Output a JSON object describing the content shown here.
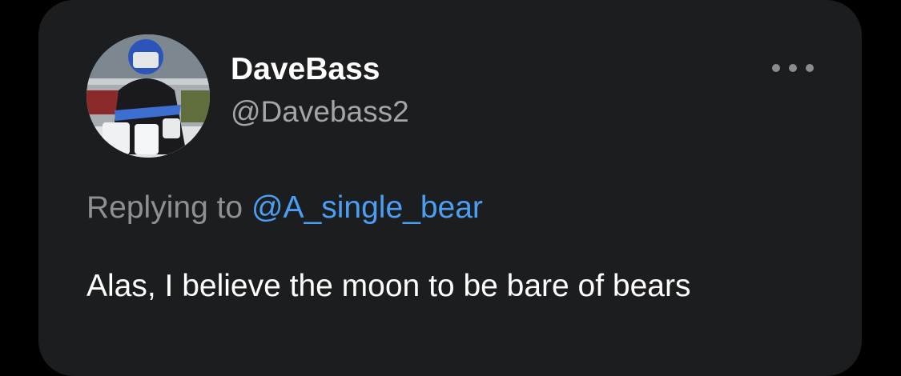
{
  "tweet": {
    "display_name": "DaveBass",
    "handle": "@Davebass2",
    "reply_prefix": "Replying to",
    "reply_mention": "@A_single_bear",
    "text": "Alas, I believe the moon to be bare of bears"
  },
  "icons": {
    "more": "more-horizontal-icon",
    "avatar": "hockey-goalie-photo"
  },
  "colors": {
    "background": "#000000",
    "card": "#1c1d1f",
    "name": "#ffffff",
    "handle": "#a3a5a9",
    "mention": "#4a9ff5"
  }
}
